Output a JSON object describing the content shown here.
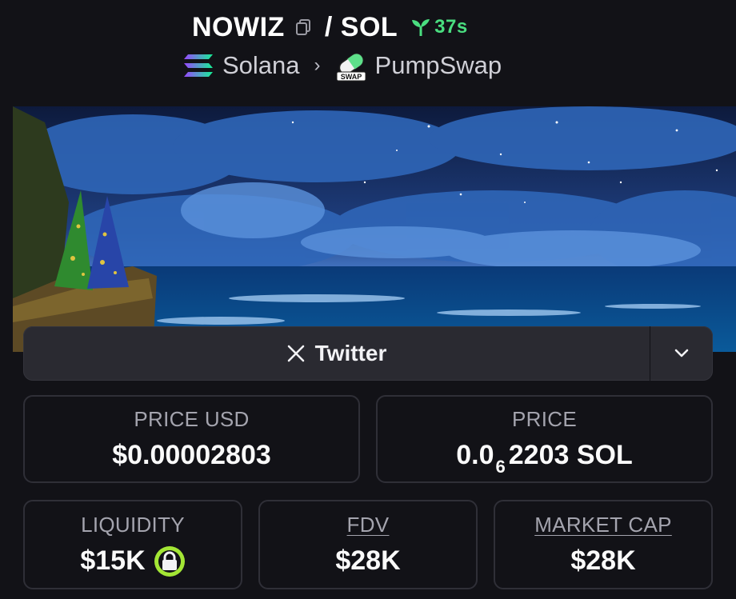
{
  "header": {
    "token": "NOWIZ",
    "slash": "/",
    "quote": "SOL",
    "age": "37s",
    "chain": "Solana",
    "dex": "PumpSwap",
    "dex_badge": "SWAP"
  },
  "social": {
    "twitter_label": "Twitter"
  },
  "stats": {
    "price_usd_label": "PRICE USD",
    "price_usd_value": "$0.00002803",
    "price_label": "PRICE",
    "price_prefix": "0.0",
    "price_zeros": "6",
    "price_rest": "2203 SOL",
    "liquidity_label": "LIQUIDITY",
    "liquidity_value": "$15K",
    "fdv_label": "FDV",
    "fdv_value": "$28K",
    "mcap_label": "MARKET CAP",
    "mcap_value": "$28K"
  },
  "colors": {
    "background": "#121217",
    "accent_green": "#4ade80",
    "lock_green": "#a3e635",
    "card_border": "#2f2f37"
  },
  "icons": [
    "copy-icon",
    "sprout-icon",
    "solana-icon",
    "chevron-right-icon",
    "pumpswap-icon",
    "x-logo-icon",
    "chevron-down-icon",
    "lock-icon"
  ]
}
